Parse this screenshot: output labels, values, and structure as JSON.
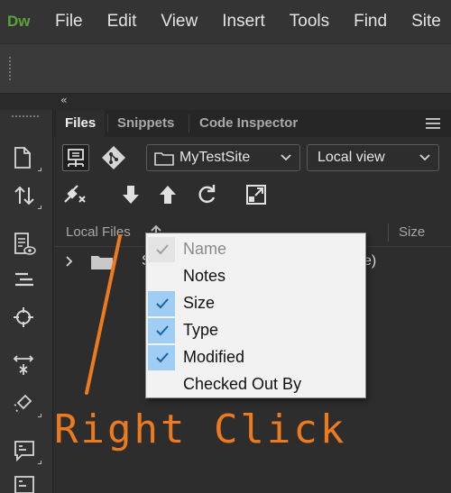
{
  "app": {
    "logo": "Dw"
  },
  "menubar": {
    "items": [
      "File",
      "Edit",
      "View",
      "Insert",
      "Tools",
      "Find",
      "Site"
    ]
  },
  "left_toolbar": {
    "icons": [
      "new-document-icon",
      "file-transfer-icon",
      "live-view-options-icon",
      "format-source-icon",
      "inspect-target-icon",
      "expand-code-icon",
      "brush-icon",
      "comment-icon",
      "code-comment-icon"
    ]
  },
  "panel": {
    "tabs": [
      "Files",
      "Snippets",
      "Code Inspector"
    ],
    "active_tab": "Files",
    "site_select": {
      "value": "MyTestSite"
    },
    "view_select": {
      "value": "Local view"
    },
    "columns": {
      "local_files": "Local Files",
      "size": "Size"
    },
    "rows": [
      {
        "name_visible": "S",
        "tail_visible": "e)"
      }
    ]
  },
  "context_menu": {
    "items": [
      {
        "label": "Name",
        "checked": true,
        "disabled": true
      },
      {
        "label": "Notes",
        "checked": false,
        "disabled": false
      },
      {
        "label": "Size",
        "checked": true,
        "disabled": false
      },
      {
        "label": "Type",
        "checked": true,
        "disabled": false
      },
      {
        "label": "Modified",
        "checked": true,
        "disabled": false
      },
      {
        "label": "Checked Out By",
        "checked": false,
        "disabled": false
      }
    ]
  },
  "annotation": {
    "text": "Right Click",
    "color": "#ee7a1e"
  },
  "colors": {
    "logo": "#5aa33a",
    "menu_check_bg": "#9fcdf3",
    "check": "#1a5fa8"
  }
}
